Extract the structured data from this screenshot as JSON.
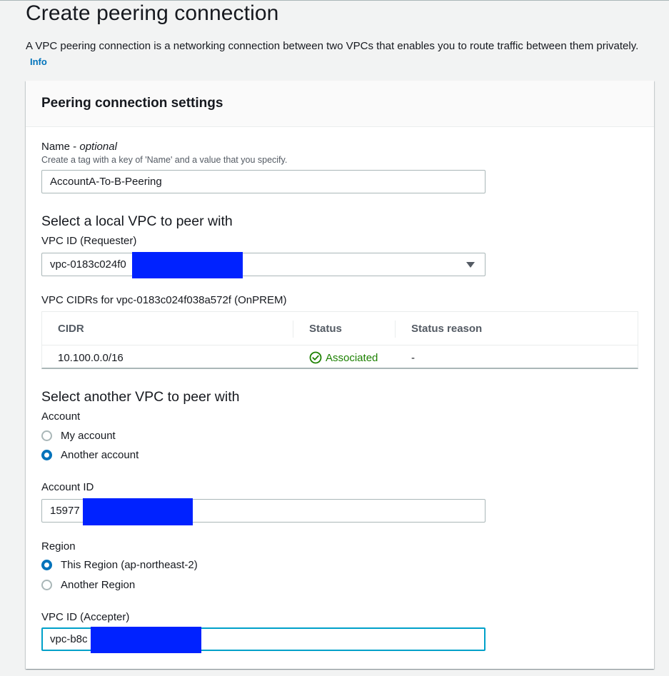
{
  "page": {
    "title": "Create peering connection",
    "description": "A VPC peering connection is a networking connection between two VPCs that enables you to route traffic between them privately.",
    "info_link": "Info"
  },
  "panel": {
    "title": "Peering connection settings"
  },
  "name_field": {
    "label": "Name",
    "label_suffix": "optional",
    "hint": "Create a tag with a key of 'Name' and a value that you specify.",
    "value": "AccountA-To-B-Peering"
  },
  "local_vpc": {
    "heading": "Select a local VPC to peer with",
    "vpc_id_label": "VPC ID (Requester)",
    "vpc_id_value": "vpc-0183c024f0",
    "cidrs_label": "VPC CIDRs for vpc-0183c024f038a572f (OnPREM)",
    "table": {
      "columns": [
        "CIDR",
        "Status",
        "Status reason"
      ],
      "rows": [
        {
          "cidr": "10.100.0.0/16",
          "status": "Associated",
          "status_reason": "-"
        }
      ]
    }
  },
  "peer_vpc": {
    "heading": "Select another VPC to peer with",
    "account_label": "Account",
    "account_options": [
      "My account",
      "Another account"
    ],
    "account_selected": "Another account",
    "account_id_label": "Account ID",
    "account_id_value": "15977",
    "region_label": "Region",
    "region_options": [
      "This Region (ap-northeast-2)",
      "Another Region"
    ],
    "region_selected": "This Region (ap-northeast-2)",
    "vpc_id_label": "VPC ID (Accepter)",
    "vpc_id_value": "vpc-b8c"
  },
  "colors": {
    "accent": "#0073bb",
    "success": "#1d8102",
    "redaction": "#0022ff",
    "focus": "#00a1c9"
  }
}
